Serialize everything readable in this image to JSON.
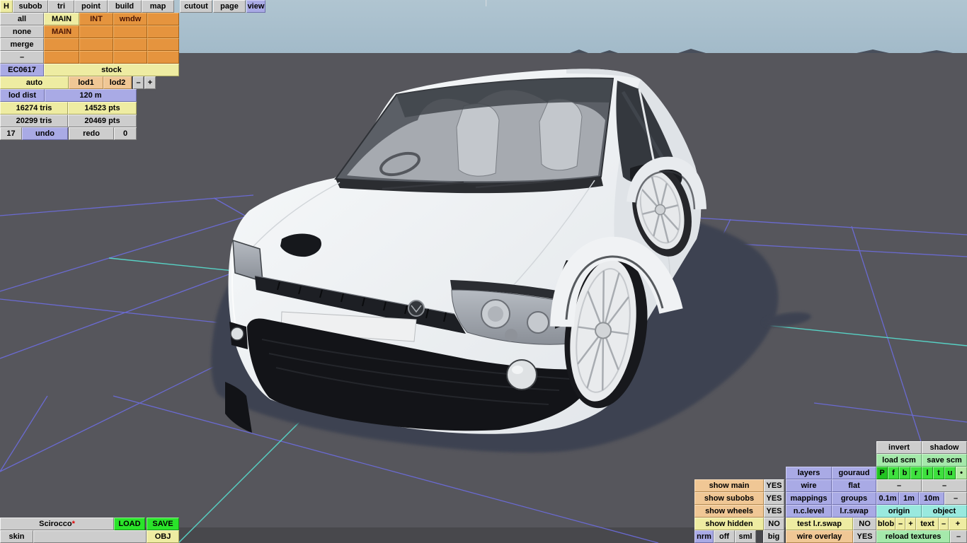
{
  "menu": {
    "items": [
      "H",
      "subob",
      "tri",
      "point",
      "build",
      "map",
      "cutout",
      "page",
      "view"
    ]
  },
  "subtable": {
    "rows": [
      "all",
      "none",
      "merge",
      "–"
    ],
    "cells": [
      [
        "MAIN",
        "INT",
        "wndw",
        ""
      ],
      [
        "MAIN",
        "",
        "",
        ""
      ],
      [
        "",
        "",
        "",
        ""
      ],
      [
        "",
        "",
        "",
        ""
      ]
    ],
    "code": "EC0617",
    "name": "stock"
  },
  "lod": {
    "auto": "auto",
    "lod1": "lod1",
    "lod2": "lod2",
    "minus": "–",
    "plus": "+",
    "dist_label": "lod dist",
    "dist_value": "120 m",
    "tris1": "16274 tris",
    "pts1": "14523 pts",
    "tris2": "20299 tris",
    "pts2": "20469 pts",
    "undo_count": "17",
    "undo": "undo",
    "redo": "redo",
    "redo_count": "0"
  },
  "file": {
    "name": "Scirocco",
    "dirty": "*",
    "load": "LOAD",
    "save": "SAVE",
    "skin_label": "skin",
    "skin_value": "",
    "obj": "OBJ"
  },
  "panel": {
    "invert": "invert",
    "shadow": "shadow",
    "load_scm": "load scm",
    "save_scm": "save scm",
    "letters": [
      "P",
      "f",
      "b",
      "r",
      "l",
      "t",
      "u"
    ],
    "dot": "•",
    "layers": "layers",
    "gouraud": "gouraud",
    "show_main": "show main",
    "show_main_v": "YES",
    "wire": "wire",
    "flat": "flat",
    "dash1": "–",
    "dash2": "–",
    "show_subobs": "show subobs",
    "show_subobs_v": "YES",
    "mappings": "mappings",
    "groups": "groups",
    "m01": "0.1m",
    "m1": "1m",
    "m10": "10m",
    "dash3": "–",
    "show_wheels": "show wheels",
    "show_wheels_v": "YES",
    "nclevel": "n.c.level",
    "lrswap": "l.r.swap",
    "origin": "origin",
    "object": "object",
    "show_hidden": "show hidden",
    "show_hidden_v": "NO",
    "test_lrswap": "test l.r.swap",
    "test_lrswap_v": "NO",
    "blob": "blob",
    "blob_minus": "–",
    "blob_plus": "+",
    "text": "text",
    "text_minus": "–",
    "text_plus": "+",
    "nrm": "nrm",
    "off": "off",
    "sml": "sml",
    "big": "big",
    "wire_overlay": "wire overlay",
    "wire_overlay_v": "YES",
    "reload": "reload textures",
    "reload_dash": "–"
  },
  "viewport": {
    "model": "white Scirocco coupe, front three-quarter view",
    "grid_color": "#6c6cd8",
    "axis_color": "#57d2c5",
    "shadow_color": "#3d4251",
    "sky_color": "#a9c0cc",
    "ground_color": "#56565c",
    "car_color": "#f2f4f6"
  }
}
